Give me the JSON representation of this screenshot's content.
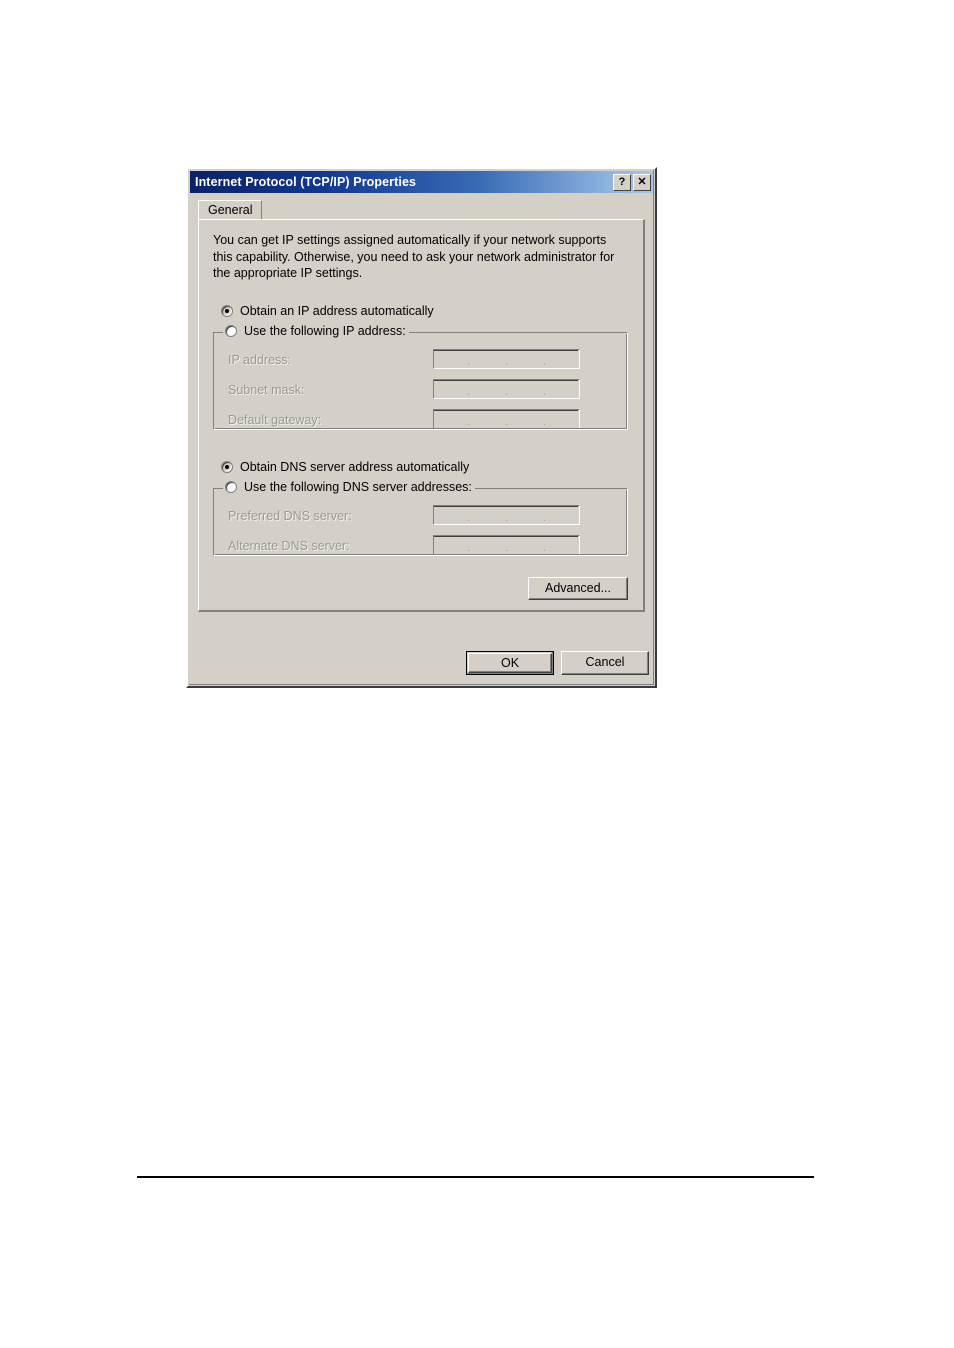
{
  "dialog": {
    "title": "Internet Protocol (TCP/IP) Properties",
    "help_button": "?",
    "close_button": "✕",
    "tabs": [
      {
        "label": "General",
        "selected": true
      }
    ],
    "description": "You can get IP settings assigned automatically if your network supports this capability. Otherwise, you need to ask your network administrator for the appropriate IP settings.",
    "ip_section": {
      "auto_radio_label": "Obtain an IP address automatically",
      "auto_radio_selected": true,
      "manual_radio_label": "Use the following IP address:",
      "manual_radio_selected": false,
      "fields": [
        {
          "label": "IP address:",
          "value": "",
          "enabled": false
        },
        {
          "label": "Subnet mask:",
          "value": "",
          "enabled": false
        },
        {
          "label": "Default gateway:",
          "value": "",
          "enabled": false
        }
      ]
    },
    "dns_section": {
      "auto_radio_label": "Obtain DNS server address automatically",
      "auto_radio_selected": true,
      "manual_radio_label": "Use the following DNS server addresses:",
      "manual_radio_selected": false,
      "fields": [
        {
          "label": "Preferred DNS server:",
          "value": "",
          "enabled": false
        },
        {
          "label": "Alternate DNS server:",
          "value": "",
          "enabled": false
        }
      ]
    },
    "advanced_button": "Advanced...",
    "ok_button": "OK",
    "cancel_button": "Cancel",
    "field_separator": "."
  },
  "colors": {
    "face": "#d4d0c8",
    "title_start": "#0b2265",
    "title_end": "#a6c6e8",
    "disabled_text": "#9a9a94"
  }
}
